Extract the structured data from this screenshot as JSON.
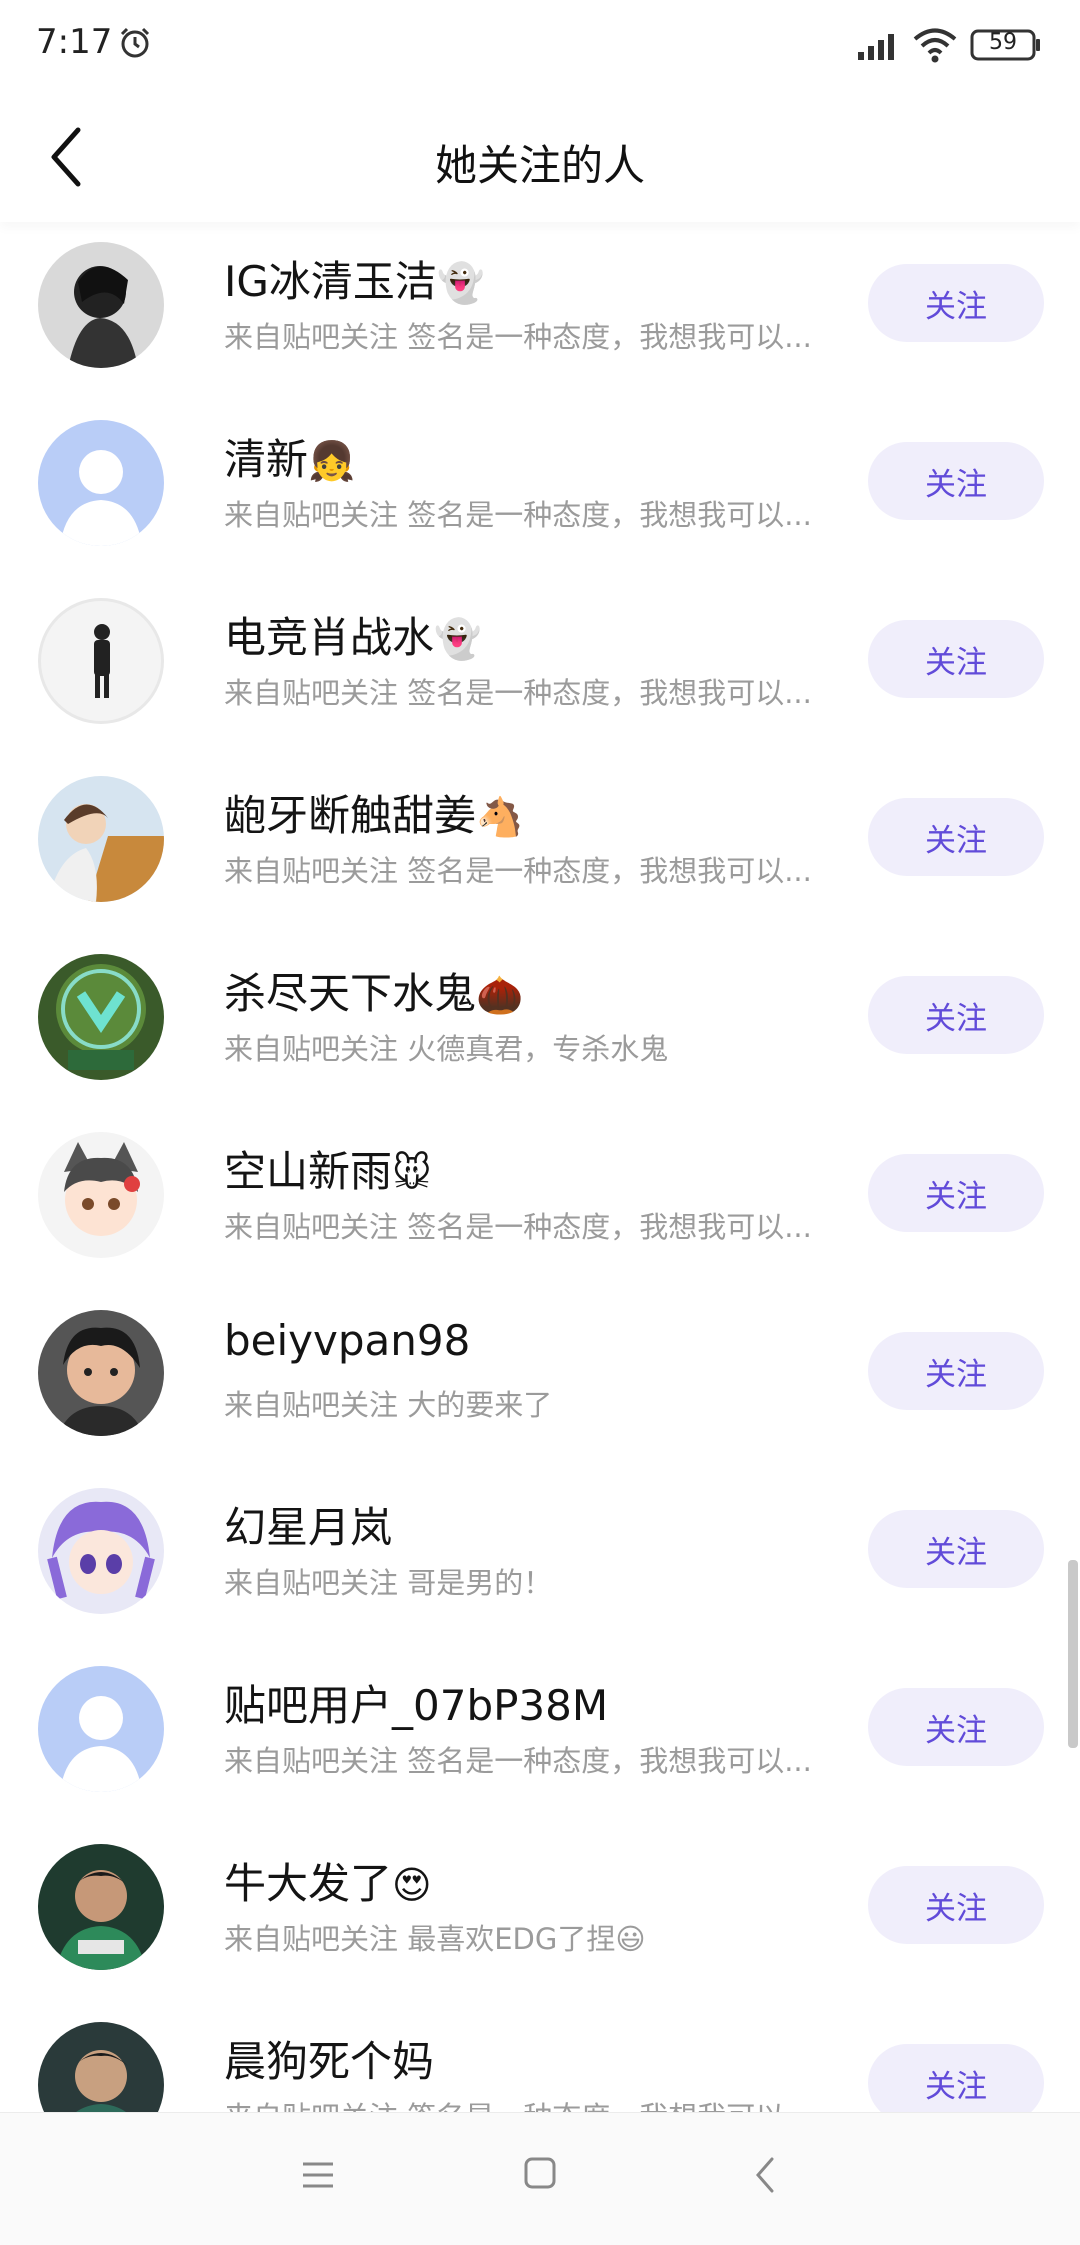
{
  "status_bar": {
    "time": "7:17",
    "battery": "59"
  },
  "header": {
    "title": "她关注的人"
  },
  "follow_label": "关注",
  "users": [
    {
      "name": "IG冰清玉洁",
      "emoji": "👻",
      "desc": "来自贴吧关注 签名是一种态度，我想我可以...",
      "desc_emoji": ""
    },
    {
      "name": "清新",
      "emoji": "👧",
      "desc": "来自贴吧关注 签名是一种态度，我想我可以...",
      "desc_emoji": ""
    },
    {
      "name": "电竞肖战水",
      "emoji": "👻",
      "desc": "来自贴吧关注 签名是一种态度，我想我可以...",
      "desc_emoji": ""
    },
    {
      "name": "龅牙断触甜姜",
      "emoji": "🐴",
      "desc": "来自贴吧关注 签名是一种态度，我想我可以...",
      "desc_emoji": ""
    },
    {
      "name": "杀尽天下水鬼",
      "emoji": "🌰",
      "desc": "来自贴吧关注 火德真君，专杀水鬼",
      "desc_emoji": ""
    },
    {
      "name": "空山新雨",
      "emoji": "🐭",
      "desc": "来自贴吧关注 签名是一种态度，我想我可以...",
      "desc_emoji": ""
    },
    {
      "name": "beiyvpan98",
      "emoji": "",
      "desc": "来自贴吧关注 大的要来了",
      "desc_emoji": ""
    },
    {
      "name": "幻星月岚",
      "emoji": "",
      "desc": "来自贴吧关注 哥是男的！",
      "desc_emoji": ""
    },
    {
      "name": "贴吧用户_07bP38M",
      "emoji": "",
      "desc": "来自贴吧关注 签名是一种态度，我想我可以...",
      "desc_emoji": ""
    },
    {
      "name": "牛大发了",
      "emoji": "😍",
      "desc": "来自贴吧关注 最喜欢EDG了捏",
      "desc_emoji": "😃"
    },
    {
      "name": "晨狗死个妈",
      "emoji": "",
      "desc": "来自贴吧关注 签名是一种态度，我想我可以...",
      "desc_emoji": ""
    }
  ],
  "icons": {
    "alarm": "alarm-icon",
    "signal": "signal-icon",
    "wifi": "wifi-icon",
    "battery": "battery-icon",
    "back": "chevron-left-icon",
    "nav_menu": "menu-icon",
    "nav_home": "square-icon",
    "nav_back": "back-icon"
  },
  "colors": {
    "accent": "#614bd9",
    "button_bg": "#f0eefb",
    "subtext": "#9b9b9b"
  }
}
